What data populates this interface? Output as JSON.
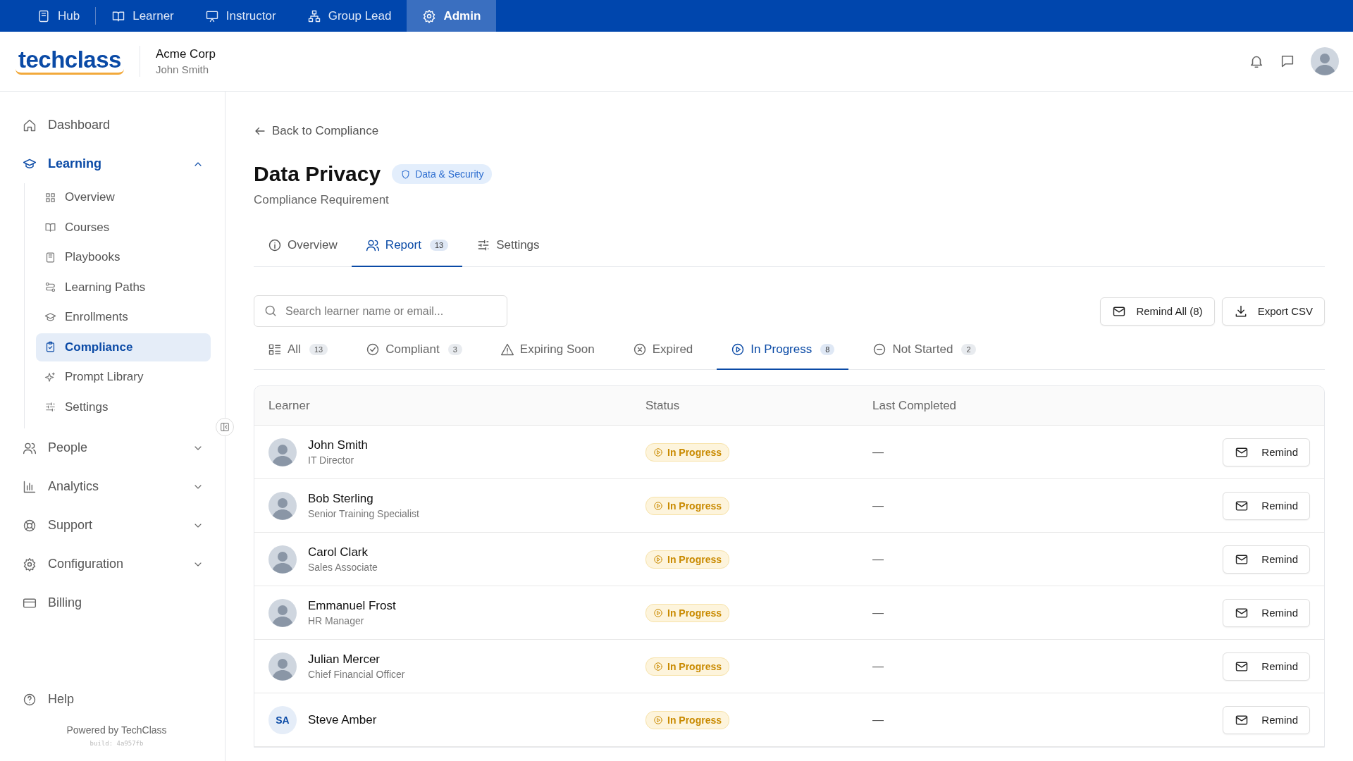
{
  "top_nav": [
    {
      "label": "Hub",
      "selected": false
    },
    {
      "label": "Learner",
      "selected": false
    },
    {
      "label": "Instructor",
      "selected": false
    },
    {
      "label": "Group Lead",
      "selected": false
    },
    {
      "label": "Admin",
      "selected": true
    }
  ],
  "header": {
    "logo": "techclass",
    "org": "Acme Corp",
    "user": "John Smith"
  },
  "sidebar": {
    "items": [
      {
        "label": "Dashboard",
        "selected": false
      },
      {
        "label": "Learning",
        "expanded": true,
        "selected": true,
        "children": [
          {
            "label": "Overview",
            "selected": false
          },
          {
            "label": "Courses",
            "selected": false
          },
          {
            "label": "Playbooks",
            "selected": false
          },
          {
            "label": "Learning Paths",
            "selected": false
          },
          {
            "label": "Enrollments",
            "selected": false
          },
          {
            "label": "Compliance",
            "selected": true
          },
          {
            "label": "Prompt Library",
            "selected": false
          },
          {
            "label": "Settings",
            "selected": false
          }
        ]
      },
      {
        "label": "People",
        "expanded": false,
        "selected": false
      },
      {
        "label": "Analytics",
        "expanded": false,
        "selected": false
      },
      {
        "label": "Support",
        "expanded": false,
        "selected": false
      },
      {
        "label": "Configuration",
        "expanded": false,
        "selected": false
      },
      {
        "label": "Billing",
        "selected": false
      }
    ],
    "help": "Help",
    "powered_by": "Powered by TechClass",
    "build": "build: 4a957fb"
  },
  "back_link": "Back to Compliance",
  "title": "Data Privacy",
  "category_tag": "Data & Security",
  "subtitle": "Compliance Requirement",
  "tabs": [
    {
      "label": "Overview",
      "selected": false
    },
    {
      "label": "Report",
      "count": "13",
      "selected": true
    },
    {
      "label": "Settings",
      "selected": false
    }
  ],
  "search": {
    "placeholder": "Search learner name or email..."
  },
  "actions": [
    "Remind All (8)",
    "Export CSV"
  ],
  "filters": [
    {
      "label": "All",
      "count": "13",
      "selected": false
    },
    {
      "label": "Compliant",
      "count": "3",
      "selected": false
    },
    {
      "label": "Expiring Soon",
      "selected": false
    },
    {
      "label": "Expired",
      "selected": false
    },
    {
      "label": "In Progress",
      "count": "8",
      "selected": true
    },
    {
      "label": "Not Started",
      "count": "2",
      "selected": false
    }
  ],
  "table": {
    "columns": [
      "Learner",
      "Status",
      "Last Completed"
    ],
    "rows": [
      {
        "kind": "photo",
        "name": "John Smith",
        "role": "IT Director",
        "status": "In Progress",
        "last_completed": "—",
        "action": "Remind"
      },
      {
        "kind": "photo",
        "name": "Bob Sterling",
        "role": "Senior Training Specialist",
        "status": "In Progress",
        "last_completed": "—",
        "action": "Remind"
      },
      {
        "kind": "photo",
        "name": "Carol Clark",
        "role": "Sales Associate",
        "status": "In Progress",
        "last_completed": "—",
        "action": "Remind"
      },
      {
        "kind": "photo",
        "name": "Emmanuel Frost",
        "role": "HR Manager",
        "status": "In Progress",
        "last_completed": "—",
        "action": "Remind"
      },
      {
        "kind": "photo",
        "name": "Julian Mercer",
        "role": "Chief Financial Officer",
        "status": "In Progress",
        "last_completed": "—",
        "action": "Remind"
      },
      {
        "kind": "initials",
        "initials": "SA",
        "name": "Steve Amber",
        "status": "In Progress",
        "last_completed": "—",
        "action": "Remind"
      }
    ]
  }
}
